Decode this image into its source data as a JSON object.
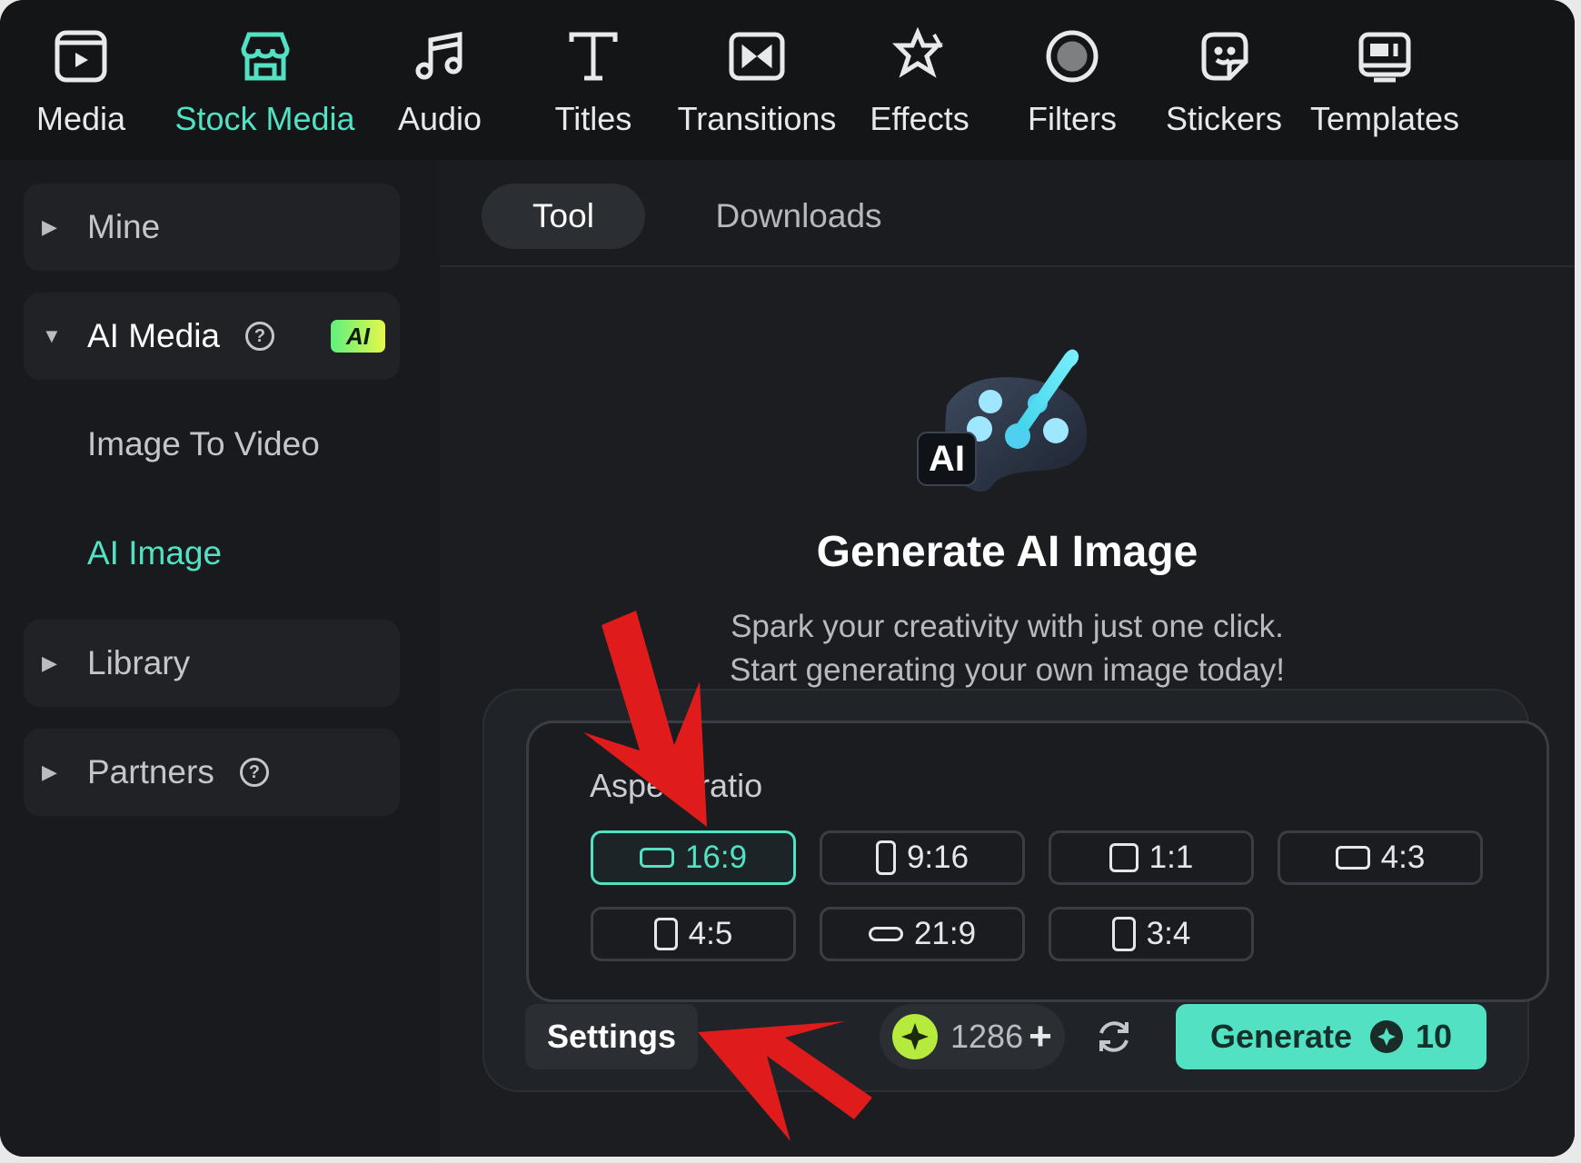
{
  "toolbar": {
    "items": [
      {
        "label": "Media",
        "icon": "media-icon"
      },
      {
        "label": "Stock Media",
        "icon": "stock-media-icon",
        "active": true
      },
      {
        "label": "Audio",
        "icon": "music-note-icon"
      },
      {
        "label": "Titles",
        "icon": "text-t-icon"
      },
      {
        "label": "Transitions",
        "icon": "transitions-icon"
      },
      {
        "label": "Effects",
        "icon": "effects-star-icon"
      },
      {
        "label": "Filters",
        "icon": "filters-icon"
      },
      {
        "label": "Stickers",
        "icon": "sticker-icon"
      },
      {
        "label": "Templates",
        "icon": "templates-icon"
      }
    ]
  },
  "sidebar": {
    "mine": "Mine",
    "ai_media": "AI Media",
    "ai_badge": "AI",
    "help_glyph": "?",
    "sub_items": [
      "Image To Video",
      "AI Image"
    ],
    "library": "Library",
    "partners": "Partners"
  },
  "tabs": {
    "tool": "Tool",
    "downloads": "Downloads"
  },
  "hero": {
    "badge": "AI",
    "title": "Generate AI Image",
    "line1": "Spark your creativity with just one click.",
    "line2": "Start generating your own image today!"
  },
  "aspect_ratio": {
    "label": "Aspect ratio",
    "options": [
      "16:9",
      "9:16",
      "1:1",
      "4:3",
      "4:5",
      "21:9",
      "3:4"
    ],
    "selected": "16:9"
  },
  "footer": {
    "settings": "Settings",
    "credits": "1286",
    "plus": "+",
    "generate": "Generate",
    "cost": "10"
  },
  "colors": {
    "accent": "#52e2c3",
    "background": "#181a1d",
    "annotation_arrow": "#e01b1b"
  }
}
